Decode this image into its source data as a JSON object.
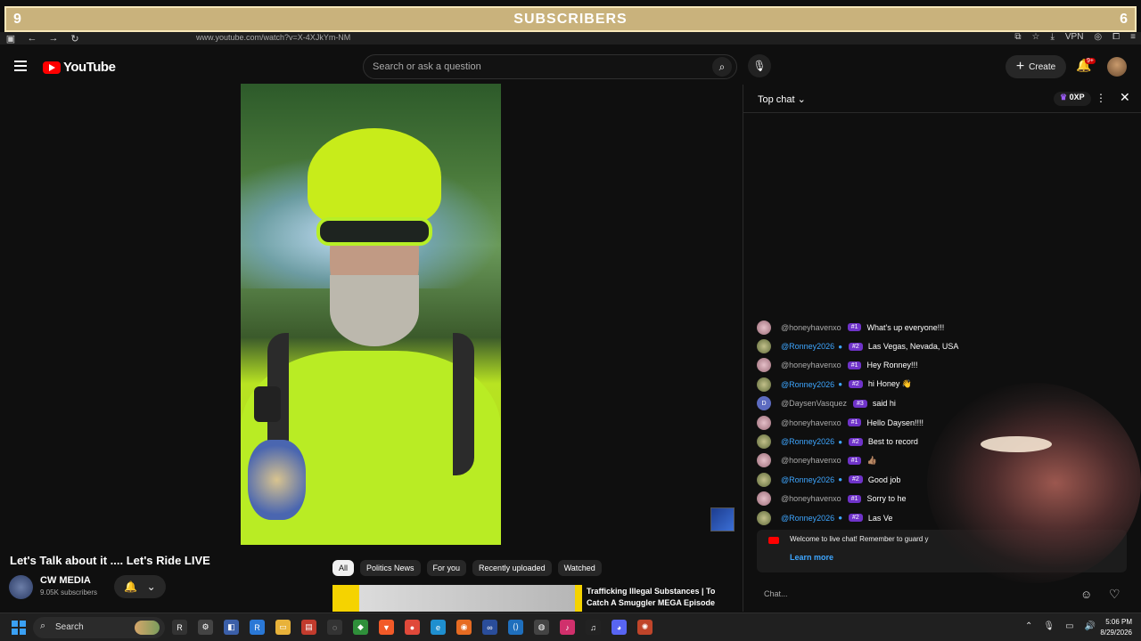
{
  "overlay": {
    "left_number": "9",
    "title": "SUBSCRIBERS",
    "right_number": "6"
  },
  "browser": {
    "url": "www.youtube.com/watch?v=X-4XJkYm-NM",
    "vpn_label": "VPN"
  },
  "header": {
    "logo_text": "YouTube",
    "search_placeholder": "Search or ask a question",
    "create_label": "Create",
    "notifications_badge": "9+"
  },
  "video": {
    "title": "Let's Talk about it .... Let's Ride LIVE",
    "channel_name": "CW MEDIA",
    "channel_subs": "9.05K subscribers"
  },
  "chips": [
    "All",
    "Politics News",
    "For you",
    "Recently uploaded",
    "Watched"
  ],
  "related": {
    "title": "Trafficking Illegal Substances | To Catch A Smuggler MEGA Episode"
  },
  "chat": {
    "mode_label": "Top chat",
    "xp_label": "0XP",
    "messages": [
      {
        "user": "@honeyhavenxo",
        "type": "honey",
        "rank": "#1",
        "text": "What's up everyone!!!"
      },
      {
        "user": "@Ronney2026",
        "type": "ron",
        "rank": "#2",
        "text": "Las Vegas, Nevada, USA"
      },
      {
        "user": "@honeyhavenxo",
        "type": "honey",
        "rank": "#1",
        "text": "Hey Ronney!!!"
      },
      {
        "user": "@Ronney2026",
        "type": "ron",
        "rank": "#2",
        "text": "hi Honey 👋"
      },
      {
        "user": "@DaysenVasquez",
        "type": "day",
        "rank": "#3",
        "text": "said hi"
      },
      {
        "user": "@honeyhavenxo",
        "type": "honey",
        "rank": "#1",
        "text": "Hello Daysen!!!!"
      },
      {
        "user": "@Ronney2026",
        "type": "ron",
        "rank": "#2",
        "text": "Best to record"
      },
      {
        "user": "@honeyhavenxo",
        "type": "honey",
        "rank": "#1",
        "text": "👍🏽"
      },
      {
        "user": "@Ronney2026",
        "type": "ron",
        "rank": "#2",
        "text": "Good job"
      },
      {
        "user": "@honeyhavenxo",
        "type": "honey",
        "rank": "#1",
        "text": "Sorry to he"
      },
      {
        "user": "@Ronney2026",
        "type": "ron",
        "rank": "#2",
        "text": "Las Ve"
      }
    ],
    "welcome_text": "Welcome to live chat! Remember to guard y",
    "learn_more": "Learn more",
    "input_placeholder": "Chat..."
  },
  "taskbar": {
    "search_label": "Search",
    "time": "5:06 PM",
    "date": "8/29/2026"
  }
}
